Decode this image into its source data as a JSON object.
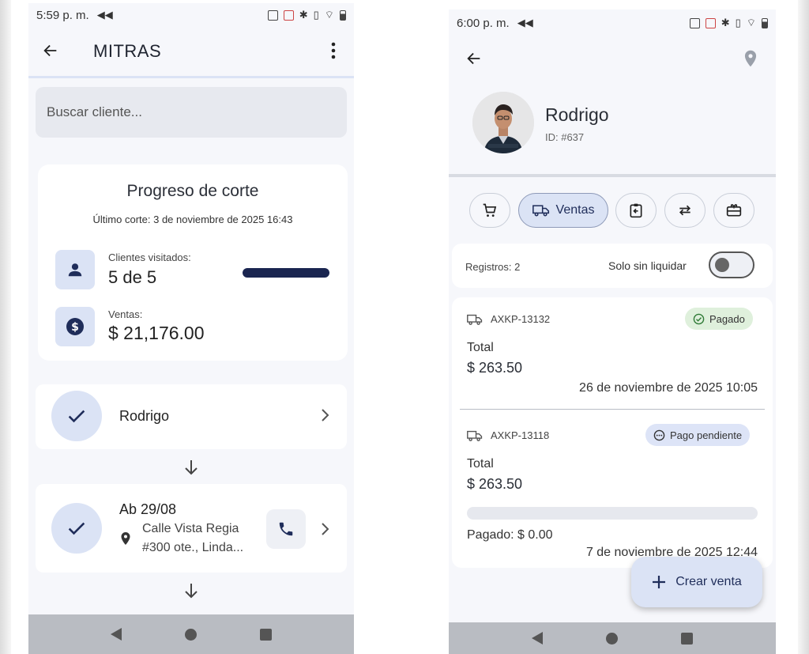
{
  "left": {
    "status": {
      "time": "5:59 p. m."
    },
    "appbar": {
      "title": "MITRAS"
    },
    "search": {
      "placeholder": "Buscar cliente..."
    },
    "progress": {
      "title": "Progreso de corte",
      "last_cut": "Último corte: 3 de noviembre de 2025 16:43",
      "visited_label": "Clientes visitados:",
      "visited_value": "5 de 5",
      "visited_fraction": 1.0,
      "sales_label": "Ventas:",
      "sales_value": "$ 21,176.00"
    },
    "route": [
      {
        "name": "Rodrigo"
      },
      {
        "name": "Ab 29/08",
        "address_line1": "Calle Vista Regia",
        "address_line2": "#300 ote., Linda..."
      }
    ]
  },
  "right": {
    "status": {
      "time": "6:00 p. m."
    },
    "client": {
      "name": "Rodrigo",
      "id": "ID: #637"
    },
    "tabs": {
      "active_label": "Ventas"
    },
    "filter": {
      "records": "Registros: 2",
      "only_unsettled": "Solo sin liquidar",
      "toggle_on": false
    },
    "sales": [
      {
        "code": "AXKP-13132",
        "status": "Pagado",
        "total_label": "Total",
        "total": "$ 263.50",
        "date": "26 de noviembre de 2025 10:05"
      },
      {
        "code": "AXKP-13118",
        "status": "Pago pendiente",
        "total_label": "Total",
        "total": "$ 263.50",
        "paid": "Pagado: $ 0.00",
        "paid_fraction": 0,
        "date": "7 de noviembre de 2025 12:44"
      }
    ],
    "fab": {
      "label": "Crear venta"
    }
  },
  "colors": {
    "accent": "#1f2d5a",
    "icon_tile": "#dbe3f5",
    "paid_badge": "#dff0dc",
    "pending_badge": "#dde4f7",
    "nav_bar": "#b9bcc2"
  }
}
